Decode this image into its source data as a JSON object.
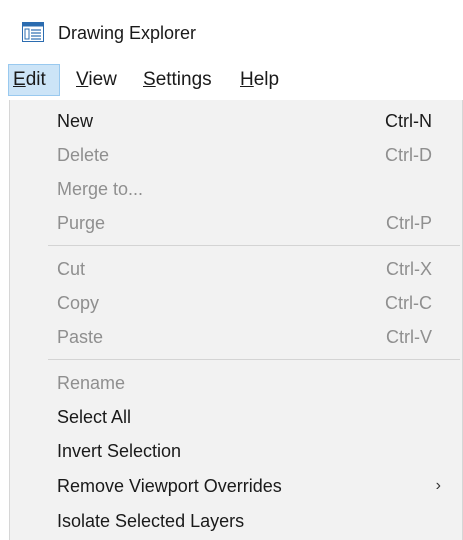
{
  "window": {
    "title": "Drawing Explorer",
    "icon": "list-window-icon"
  },
  "menubar": [
    {
      "label_ul": "E",
      "label_rest": "dit",
      "active": true
    },
    {
      "label_ul": "V",
      "label_rest": "iew",
      "active": false
    },
    {
      "label_ul": "S",
      "label_rest": "ettings",
      "active": false
    },
    {
      "label_ul": "H",
      "label_rest": "elp",
      "active": false
    }
  ],
  "edit_menu": {
    "items": [
      {
        "label": "New",
        "shortcut": "Ctrl-N",
        "enabled": true
      },
      {
        "label": "Delete",
        "shortcut": "Ctrl-D",
        "enabled": false
      },
      {
        "label": "Merge to...",
        "shortcut": "",
        "enabled": false
      },
      {
        "label": "Purge",
        "shortcut": "Ctrl-P",
        "enabled": false
      },
      {
        "label": "Cut",
        "shortcut": "Ctrl-X",
        "enabled": false
      },
      {
        "label": "Copy",
        "shortcut": "Ctrl-C",
        "enabled": false
      },
      {
        "label": "Paste",
        "shortcut": "Ctrl-V",
        "enabled": false
      },
      {
        "label": "Rename",
        "shortcut": "",
        "enabled": false
      },
      {
        "label": "Select All",
        "shortcut": "",
        "enabled": true
      },
      {
        "label": "Invert Selection",
        "shortcut": "",
        "enabled": true
      },
      {
        "label": "Remove Viewport Overrides",
        "shortcut": "",
        "enabled": true,
        "submenu_arrow": "›"
      },
      {
        "label": "Isolate Selected Layers",
        "shortcut": "",
        "enabled": true
      }
    ]
  },
  "colors": {
    "menu_background": "#f2f2f2",
    "active_menu_highlight": "#cce4f7",
    "disabled_text": "#8f8f8f",
    "enabled_text": "#1a1a1a"
  }
}
